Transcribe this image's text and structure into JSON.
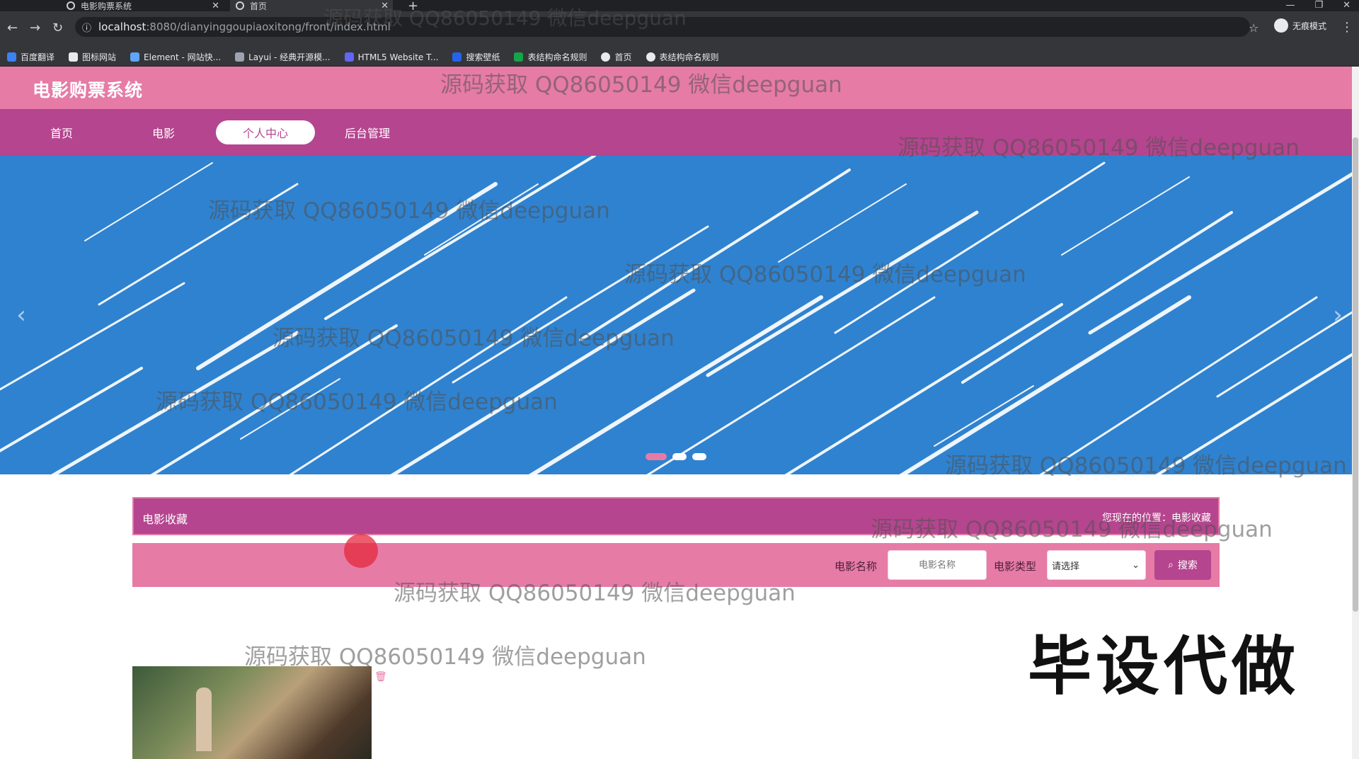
{
  "browser": {
    "tabs": [
      {
        "label": "电影购票系统"
      },
      {
        "label": "首页"
      }
    ],
    "url_host": "localhost",
    "url_path": ":8080/dianyinggoupiaoxitong/front/index.html",
    "profile_label": "无痕模式",
    "bookmarks": [
      {
        "label": "百度翻译"
      },
      {
        "label": "图标网站"
      },
      {
        "label": "Element - 网站快..."
      },
      {
        "label": "Layui - 经典开源模..."
      },
      {
        "label": "HTML5 Website T..."
      },
      {
        "label": "搜索壁纸"
      },
      {
        "label": "表结构命名规则"
      },
      {
        "label": "首页"
      },
      {
        "label": "表结构命名规则"
      }
    ]
  },
  "site": {
    "title": "电影购票系统",
    "nav": [
      {
        "label": "首页"
      },
      {
        "label": "电影"
      },
      {
        "label": "个人中心"
      },
      {
        "label": "后台管理"
      }
    ]
  },
  "section": {
    "title": "电影收藏",
    "breadcrumb": "您现在的位置：电影收藏"
  },
  "search": {
    "name_label": "电影名称",
    "name_placeholder": "电影名称",
    "type_label": "电影类型",
    "type_selected": "请选择",
    "button_label": "搜索"
  },
  "watermark": {
    "text": "源码获取 QQ86050149 微信deepguan",
    "overlay": "毕设代做"
  },
  "colors": {
    "header_pink": "#e67ba6",
    "nav_magenta": "#b5458f",
    "banner_blue": "#2f82cf"
  }
}
